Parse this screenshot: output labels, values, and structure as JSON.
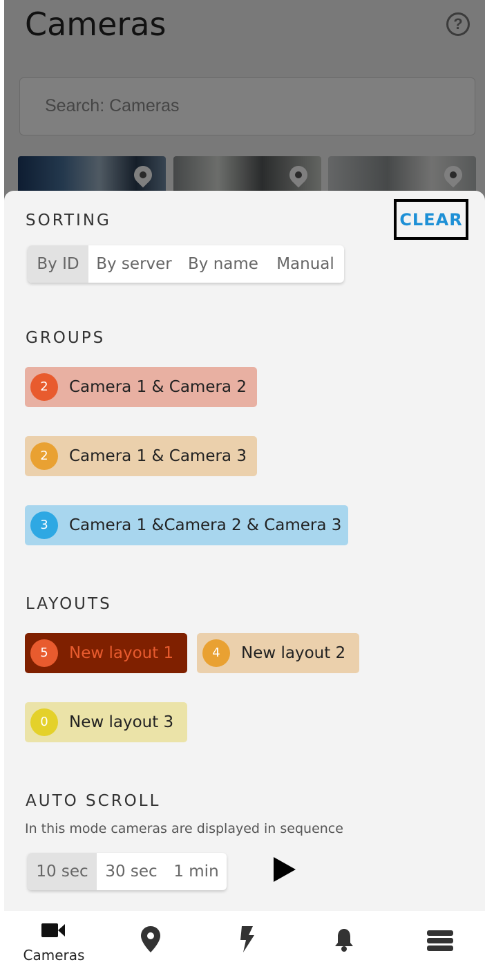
{
  "background": {
    "title": "Cameras",
    "search_placeholder": "Search: Cameras",
    "help_icon": "help-circle-icon"
  },
  "sheet": {
    "clear_label": "CLEAR",
    "sorting": {
      "title": "SORTING",
      "options": [
        "By ID",
        "By server",
        "By name",
        "Manual"
      ],
      "selected": "By ID"
    },
    "groups": {
      "title": "GROUPS",
      "items": [
        {
          "count": "2",
          "label": "Camera 1 & Camera 2",
          "badge_color": "#e85b2e",
          "chip_color": "#e8b0a2"
        },
        {
          "count": "2",
          "label": "Camera 1 & Camera 3",
          "badge_color": "#e9a132",
          "chip_color": "#ebd0ac"
        },
        {
          "count": "3",
          "label": "Camera 1 &Camera 2 & Camera 3",
          "badge_color": "#2ea8e3",
          "chip_color": "#a8d6ee"
        }
      ]
    },
    "layouts": {
      "title": "LAYOUTS",
      "items": [
        {
          "count": "5",
          "label": "New layout 1",
          "badge_color": "#e85b2e",
          "chip_color": "#7f2000",
          "selected": true
        },
        {
          "count": "4",
          "label": "New layout 2",
          "badge_color": "#e9a132",
          "chip_color": "#ebd0ac",
          "selected": false
        },
        {
          "count": "0",
          "label": "New layout 3",
          "badge_color": "#e4d12a",
          "chip_color": "#ebe3a8",
          "selected": false
        }
      ]
    },
    "auto_scroll": {
      "title": "AUTO SCROLL",
      "hint": "In this mode cameras are displayed in sequence",
      "options": [
        "10 sec",
        "30 sec",
        "1 min"
      ],
      "selected": "10 sec",
      "play_icon": "play-icon"
    }
  },
  "bottom_nav": {
    "items": [
      {
        "label": "Cameras",
        "icon": "video-camera-icon",
        "active": true
      },
      {
        "label": "",
        "icon": "map-pin-icon",
        "active": false
      },
      {
        "label": "",
        "icon": "lightning-icon",
        "active": false
      },
      {
        "label": "",
        "icon": "bell-icon",
        "active": false
      },
      {
        "label": "",
        "icon": "server-stack-icon",
        "active": false
      }
    ]
  }
}
